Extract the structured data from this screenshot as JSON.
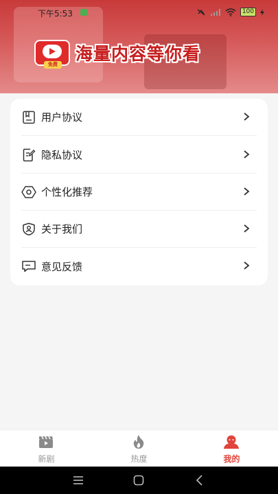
{
  "status_bar": {
    "time": "下午5:53",
    "battery": "100"
  },
  "banner": {
    "logo_badge": "免费",
    "slogan": "海量内容等你看"
  },
  "menu": {
    "items": [
      {
        "label": "用户协议",
        "icon": "document-icon"
      },
      {
        "label": "隐私协议",
        "icon": "privacy-edit-icon"
      },
      {
        "label": "个性化推荐",
        "icon": "settings-gear-icon"
      },
      {
        "label": "关于我们",
        "icon": "shield-user-icon"
      },
      {
        "label": "意见反馈",
        "icon": "feedback-message-icon"
      }
    ]
  },
  "tabbar": {
    "tabs": [
      {
        "label": "新剧",
        "icon": "clapperboard-icon",
        "active": false
      },
      {
        "label": "热度",
        "icon": "flame-icon",
        "active": false
      },
      {
        "label": "我的",
        "icon": "profile-icon",
        "active": true
      }
    ]
  },
  "colors": {
    "accent": "#e0443a",
    "header_red": "#c83a3a",
    "inactive_tab": "#999999"
  }
}
